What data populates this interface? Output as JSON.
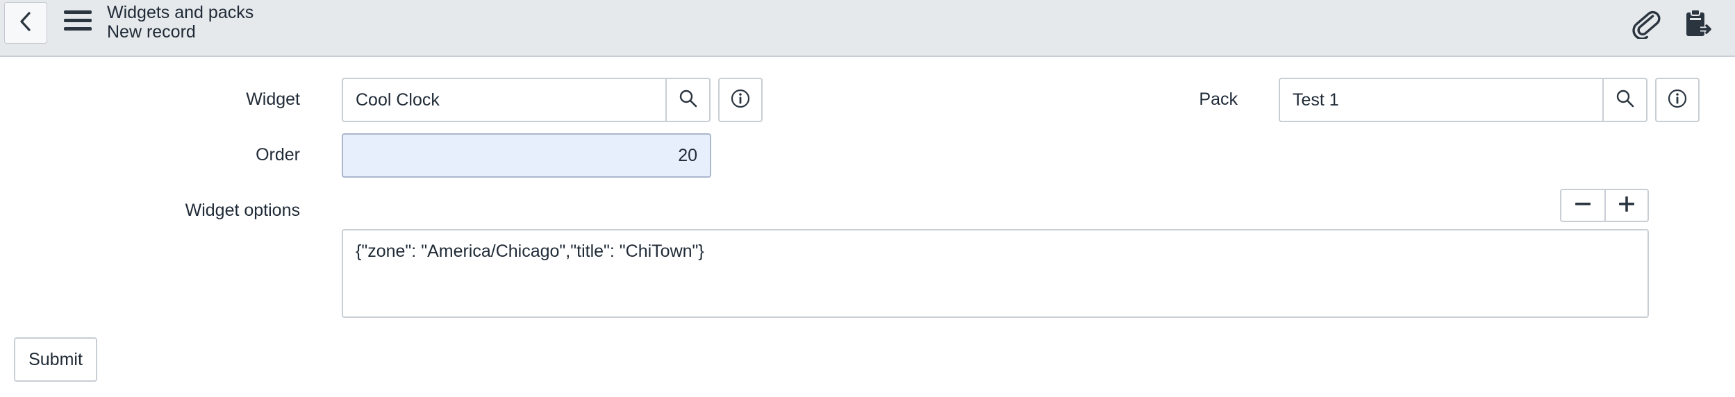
{
  "header": {
    "title": "Widgets and packs",
    "subtitle": "New record",
    "icons": {
      "back": "chevron-left-icon",
      "menu": "hamburger-menu-icon",
      "attachment": "paperclip-icon",
      "context": "clipboard-icon"
    }
  },
  "form": {
    "widget": {
      "label": "Widget",
      "value": "Cool Clock"
    },
    "pack": {
      "label": "Pack",
      "value": "Test 1"
    },
    "order": {
      "label": "Order",
      "value": "20"
    },
    "widget_options": {
      "label": "Widget options",
      "value": "{\"zone\": \"America/Chicago\",\"title\": \"ChiTown\"}"
    }
  },
  "actions": {
    "submit_label": "Submit"
  },
  "colors": {
    "header_bg": "#e6e9ec",
    "order_field_bg": "#e8effc",
    "border": "#c9ced4",
    "text": "#1f2a36"
  }
}
